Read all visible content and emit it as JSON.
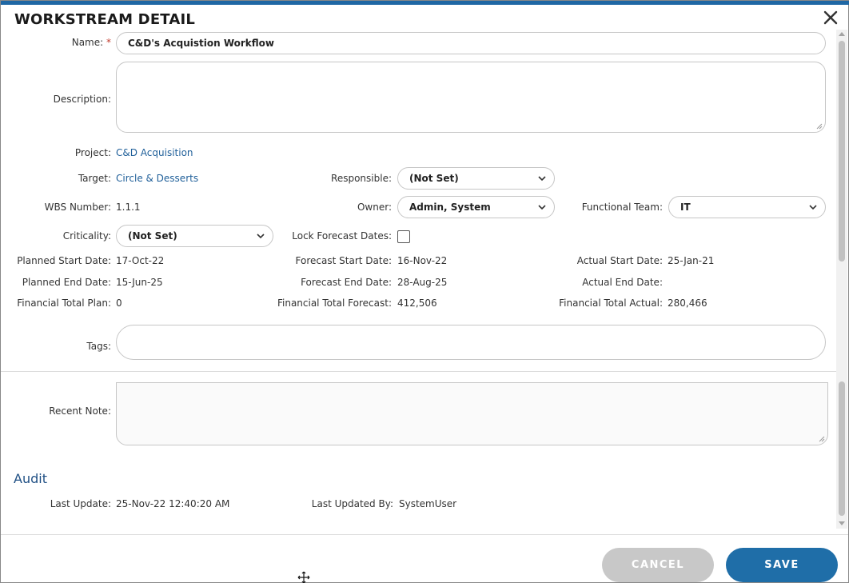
{
  "dialog": {
    "title": "WORKSTREAM DETAIL",
    "close_icon": "close-icon"
  },
  "form": {
    "name": {
      "label": "Name:",
      "required_mark": "*",
      "value": "C&D's Acquistion Workflow"
    },
    "description": {
      "label": "Description:",
      "value": ""
    },
    "project": {
      "label": "Project:",
      "value": "C&D Acquisition"
    },
    "target": {
      "label": "Target:",
      "value": "Circle & Desserts"
    },
    "responsible": {
      "label": "Responsible:",
      "value": "(Not Set)"
    },
    "wbs_number": {
      "label": "WBS Number:",
      "value": "1.1.1"
    },
    "owner": {
      "label": "Owner:",
      "value": "Admin, System"
    },
    "functional_team": {
      "label": "Functional Team:",
      "value": "IT"
    },
    "criticality": {
      "label": "Criticality:",
      "value": "(Not Set)"
    },
    "lock_forecast_dates": {
      "label": "Lock Forecast Dates:",
      "checked": false
    },
    "planned_start": {
      "label": "Planned Start Date:",
      "value": "17-Oct-22"
    },
    "forecast_start": {
      "label": "Forecast Start Date:",
      "value": "16-Nov-22"
    },
    "actual_start": {
      "label": "Actual Start Date:",
      "value": "25-Jan-21"
    },
    "planned_end": {
      "label": "Planned End Date:",
      "value": "15-Jun-25"
    },
    "forecast_end": {
      "label": "Forecast End Date:",
      "value": "28-Aug-25"
    },
    "actual_end": {
      "label": "Actual End Date:",
      "value": ""
    },
    "financial_plan": {
      "label": "Financial Total Plan:",
      "value": "0"
    },
    "financial_forecast": {
      "label": "Financial Total Forecast:",
      "value": "412,506"
    },
    "financial_actual": {
      "label": "Financial Total Actual:",
      "value": "280,466"
    },
    "tags": {
      "label": "Tags:",
      "value": ""
    },
    "recent_note": {
      "label": "Recent Note:",
      "value": ""
    }
  },
  "audit": {
    "heading": "Audit",
    "last_update": {
      "label": "Last Update:",
      "value": "25-Nov-22 12:40:20 AM"
    },
    "last_updated_by": {
      "label": "Last Updated By:",
      "value": "SystemUser"
    }
  },
  "buttons": {
    "cancel": "CANCEL",
    "save": "SAVE"
  },
  "colors": {
    "accent": "#1f67a4",
    "link": "#1f5f99",
    "save_button": "#1f6ea8",
    "cancel_button": "#c8c8c8",
    "required": "#c0392b"
  }
}
